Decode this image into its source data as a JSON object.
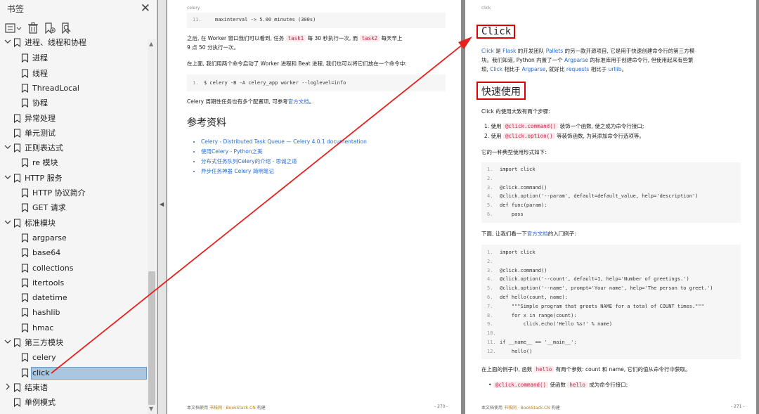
{
  "sidebar": {
    "title": "书签",
    "items": [
      {
        "label": "进程、线程和协程",
        "level": 0,
        "expanded": true
      },
      {
        "label": "进程",
        "level": 1
      },
      {
        "label": "线程",
        "level": 1
      },
      {
        "label": "ThreadLocal",
        "level": 1
      },
      {
        "label": "协程",
        "level": 1
      },
      {
        "label": "异常处理",
        "level": 0
      },
      {
        "label": "单元测试",
        "level": 0
      },
      {
        "label": "正则表达式",
        "level": 0,
        "expanded": true
      },
      {
        "label": "re 模块",
        "level": 1
      },
      {
        "label": "HTTP 服务",
        "level": 0,
        "expanded": true
      },
      {
        "label": "HTTP 协议简介",
        "level": 1
      },
      {
        "label": "GET 请求",
        "level": 1
      },
      {
        "label": "标准模块",
        "level": 0,
        "expanded": true
      },
      {
        "label": "argparse",
        "level": 1
      },
      {
        "label": "base64",
        "level": 1
      },
      {
        "label": "collections",
        "level": 1
      },
      {
        "label": "itertools",
        "level": 1
      },
      {
        "label": "datetime",
        "level": 1
      },
      {
        "label": "hashlib",
        "level": 1
      },
      {
        "label": "hmac",
        "level": 1
      },
      {
        "label": "第三方模块",
        "level": 0,
        "expanded": true
      },
      {
        "label": "celery",
        "level": 1
      },
      {
        "label": "click",
        "level": 1,
        "selected": true
      },
      {
        "label": "结束语",
        "level": 0,
        "collapsed": true
      },
      {
        "label": "单例模式",
        "level": 0
      }
    ]
  },
  "page1": {
    "header": "celery",
    "code_top": {
      "num": "11.",
      "text": "maxinterval -> 5.00 minutes (300s)"
    },
    "para1": {
      "a": "之后, 在 Worker 窗口我们可以看到, 任务",
      "tag1": "task1",
      "b": "每 30 秒执行一次, 而",
      "tag2": "task2",
      "c": "每天早上",
      "d": "9 点 50 分执行一次。"
    },
    "para2": "在上面, 我们用两个命令启动了 Worker 进程和 Beat 进程, 我们也可以将它们放在一个命令中:",
    "code2": {
      "num": "1.",
      "text": "$ celery -B -A celery_app worker --loglevel=info"
    },
    "para3": {
      "a": "Celery 周期性任务也有多个配置项, 可参考",
      "link": "官方文档",
      "b": "。"
    },
    "refs_title": "参考资料",
    "refs": [
      "Celery - Distributed Task Queue — Celery 4.0.1 documentation",
      "使用Celery - Python之美",
      "分布式任务队列Celery的介绍 - 思诚之道",
      "异步任务神器 Celery 简明笔记"
    ],
    "footer_a": "本文档使用",
    "footer_b": "书栈网 · BookStack.CN",
    "footer_c": "构建",
    "page_num": "- 270 -"
  },
  "page2": {
    "header": "click",
    "title": "Click",
    "intro1": {
      "a": "Click",
      "b": "是",
      "c": "Flask",
      "d": "的开发团队",
      "e": "Pallets",
      "f": "的另一款开源项目, 它是用于快速创建命令行的第三方模"
    },
    "intro2": {
      "a": "块。我们知道, Python 内置了一个",
      "b": "Argparse",
      "c": "的标准库用于创建命令行, 但使用起来有些繁"
    },
    "intro3": {
      "a": "琐,",
      "b": "Click",
      "c": "相比于",
      "d": "Argparse",
      "e": ", 就好比",
      "f": "requests",
      "g": "相比于",
      "h": "urllib",
      "i": "。"
    },
    "h_quick": "快速使用",
    "steps_intro": "Click 的使用大致有两个步骤:",
    "steps": [
      {
        "n": "1.",
        "a": "使用",
        "tag": "@click.command()",
        "b": "装饰一个函数, 使之成为命令行接口;"
      },
      {
        "n": "2.",
        "a": "使用",
        "tag": "@click.option()",
        "b": "等装饰函数, 为其添加命令行选项等。"
      }
    ],
    "typical": "它的一种典型使用形式如下:",
    "code1": [
      {
        "n": "1.",
        "t": "import click"
      },
      {
        "n": "2.",
        "t": ""
      },
      {
        "n": "3.",
        "t": "@click.command()"
      },
      {
        "n": "4.",
        "t": "@click.option('--param', default=default_value, help='description')"
      },
      {
        "n": "5.",
        "t": "def func(param):"
      },
      {
        "n": "6.",
        "t": "    pass"
      }
    ],
    "example_intro": {
      "a": "下面, 让我们看一下",
      "link": "官方文档",
      "b": "的入门例子:"
    },
    "code2": [
      {
        "n": "1.",
        "t": "import click"
      },
      {
        "n": "2.",
        "t": ""
      },
      {
        "n": "3.",
        "t": "@click.command()"
      },
      {
        "n": "4.",
        "t": "@click.option('--count', default=1, help='Number of greetings.')"
      },
      {
        "n": "5.",
        "t": "@click.option('--name', prompt='Your name', help='The person to greet.')"
      },
      {
        "n": "6.",
        "t": "def hello(count, name):"
      },
      {
        "n": "7.",
        "t": "    \"\"\"Simple program that greets NAME for a total of COUNT times.\"\"\""
      },
      {
        "n": "8.",
        "t": "    for x in range(count):"
      },
      {
        "n": "9.",
        "t": "        click.echo('Hello %s!' % name)"
      },
      {
        "n": "10.",
        "t": ""
      },
      {
        "n": "11.",
        "t": "if __name__ == '__main__':"
      },
      {
        "n": "12.",
        "t": "    hello()"
      }
    ],
    "after_code": {
      "a": "在上面的例子中, 函数",
      "tag": "hello",
      "b": "有两个参数: count 和 name, 它们的值从命令行中获取。"
    },
    "bullet": {
      "tag": "@click.command()",
      "a": "使函数",
      "tag2": "hello",
      "b": "成为命令行接口;"
    },
    "footer_a": "本文档使用",
    "footer_b": "书栈网 · BookStack.CN",
    "footer_c": "构建",
    "page_num": "- 271 -"
  }
}
